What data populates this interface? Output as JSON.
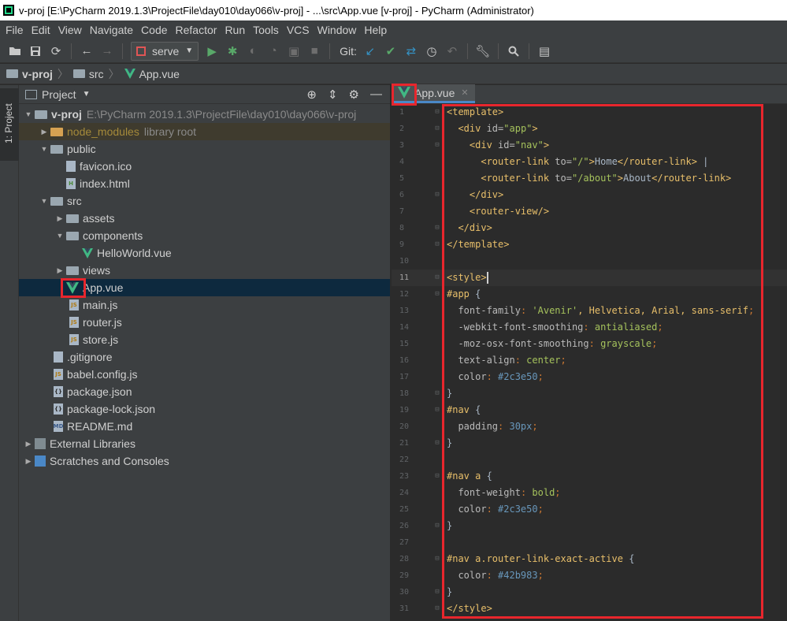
{
  "window": {
    "title": "v-proj [E:\\PyCharm 2019.1.3\\ProjectFile\\day010\\day066\\v-proj] - ...\\src\\App.vue [v-proj] - PyCharm (Administrator)"
  },
  "menu": [
    "File",
    "Edit",
    "View",
    "Navigate",
    "Code",
    "Refactor",
    "Run",
    "Tools",
    "VCS",
    "Window",
    "Help"
  ],
  "toolbar": {
    "run_config": "serve",
    "git_label": "Git:"
  },
  "breadcrumb": [
    "v-proj",
    "src",
    "App.vue"
  ],
  "tool_strip": {
    "project_tab": "1: Project"
  },
  "project_panel": {
    "title": "Project",
    "root_name": "v-proj",
    "root_path": "E:\\PyCharm 2019.1.3\\ProjectFile\\day010\\day066\\v-proj",
    "node_modules": "node_modules",
    "node_modules_hint": "library root",
    "items": [
      {
        "label": "public"
      },
      {
        "label": "favicon.ico"
      },
      {
        "label": "index.html"
      },
      {
        "label": "src"
      },
      {
        "label": "assets"
      },
      {
        "label": "components"
      },
      {
        "label": "HelloWorld.vue"
      },
      {
        "label": "views"
      },
      {
        "label": "App.vue"
      },
      {
        "label": "main.js"
      },
      {
        "label": "router.js"
      },
      {
        "label": "store.js"
      },
      {
        "label": ".gitignore"
      },
      {
        "label": "babel.config.js"
      },
      {
        "label": "package.json"
      },
      {
        "label": "package-lock.json"
      },
      {
        "label": "README.md"
      },
      {
        "label": "External Libraries"
      },
      {
        "label": "Scratches and Consoles"
      }
    ]
  },
  "editor": {
    "tab_label": "App.vue",
    "line_numbers": [
      "1",
      "2",
      "3",
      "4",
      "5",
      "6",
      "7",
      "8",
      "9",
      "10",
      "11",
      "12",
      "13",
      "14",
      "15",
      "16",
      "17",
      "18",
      "19",
      "20",
      "21",
      "22",
      "23",
      "24",
      "25",
      "26",
      "27",
      "28",
      "29",
      "30",
      "31"
    ],
    "code": {
      "l1_tag": "<template>",
      "l2_open": "<div ",
      "l2_attr": "id=",
      "l2_str": "\"app\"",
      "l2_close": ">",
      "l3_open": "<div ",
      "l3_attr": "id=",
      "l3_str": "\"nav\"",
      "l3_close": ">",
      "l4_open": "<router-link ",
      "l4_attr": "to=",
      "l4_str": "\"/\"",
      "l4_close": ">",
      "l4_text": "Home",
      "l4_end": "</router-link>",
      "l4_pipe": " |",
      "l5_open": "<router-link ",
      "l5_attr": "to=",
      "l5_str": "\"/about\"",
      "l5_close": ">",
      "l5_text": "About",
      "l5_end": "</router-link>",
      "l6_tag": "</div>",
      "l7_tag": "<router-view/>",
      "l8_tag": "</div>",
      "l9_tag": "</template>",
      "l11_tag": "<style>",
      "l12_sel": "#app",
      "l12_brace": " {",
      "l13_prop": "font-family",
      "l13_val1": "'Avenir'",
      "l13_rest": ", Helvetica, Arial, sans-serif",
      "l14_prop": "-webkit-font-smoothing",
      "l14_val": "antialiased",
      "l15_prop": "-moz-osx-font-smoothing",
      "l15_val": "grayscale",
      "l16_prop": "text-align",
      "l16_val": "center",
      "l17_prop": "color",
      "l17_val": "#2c3e50",
      "l18_brace": "}",
      "l19_sel": "#nav",
      "l19_brace": " {",
      "l20_prop": "padding",
      "l20_val": "30px",
      "l21_brace": "}",
      "l23_sel": "#nav a",
      "l23_brace": " {",
      "l24_prop": "font-weight",
      "l24_val": "bold",
      "l25_prop": "color",
      "l25_val": "#2c3e50",
      "l26_brace": "}",
      "l28_sel": "#nav a.router-link-exact-active",
      "l28_brace": " {",
      "l29_prop": "color",
      "l29_val": "#42b983",
      "l30_brace": "}",
      "l31_tag": "</style>"
    }
  },
  "colors": {
    "annotation": "#e8262d",
    "vue_green": "#41b883",
    "vue_dark": "#35495e"
  }
}
